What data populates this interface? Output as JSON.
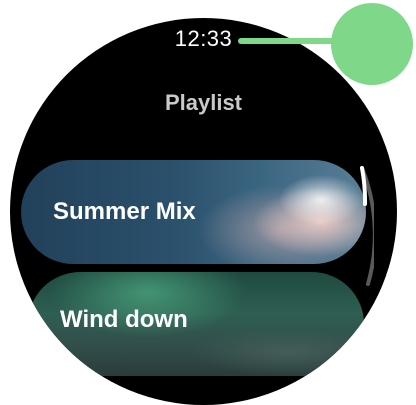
{
  "status": {
    "time": "12:33"
  },
  "header": {
    "title": "Playlist"
  },
  "playlists": [
    {
      "label": "Summer Mix"
    },
    {
      "label": "Wind down"
    }
  ],
  "colors": {
    "screen_background": "#000000",
    "title_text": "#c9c9c9",
    "pointer_marker": "#7fd889"
  }
}
